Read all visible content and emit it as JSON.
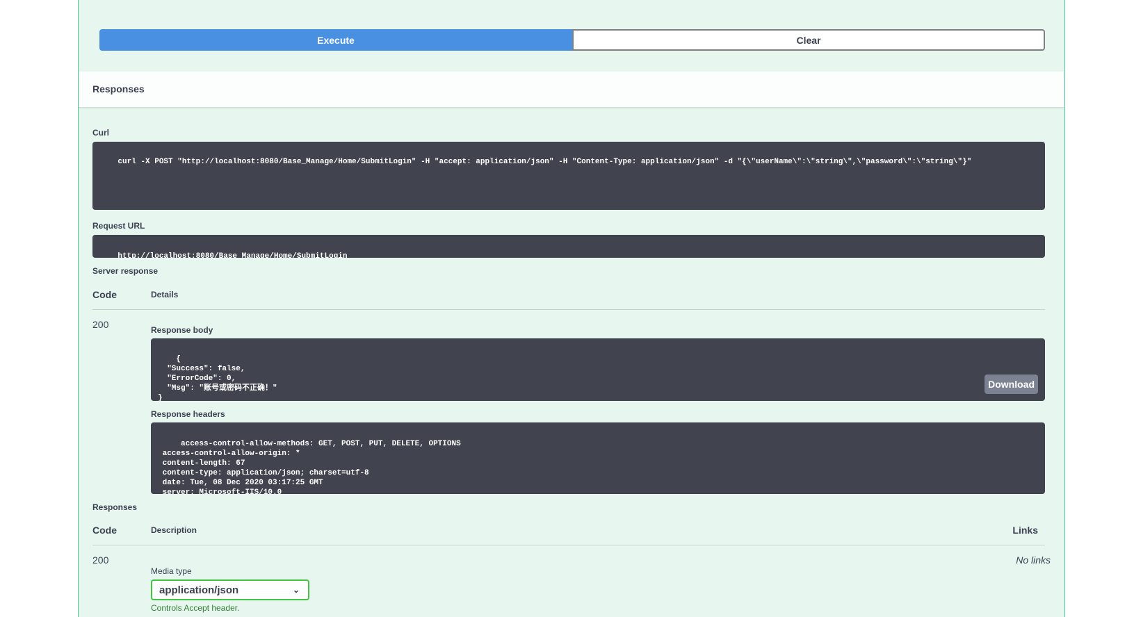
{
  "buttons": {
    "execute": "Execute",
    "clear": "Clear"
  },
  "responses_title": "Responses",
  "curl": {
    "label": "Curl",
    "command": "curl -X POST \"http://localhost:8080/Base_Manage/Home/SubmitLogin\" -H \"accept: application/json\" -H \"Content-Type: application/json\" -d \"{\\\"userName\\\":\\\"string\\\",\\\"password\\\":\\\"string\\\"}\""
  },
  "request_url": {
    "label": "Request URL",
    "value": "http://localhost:8080/Base_Manage/Home/SubmitLogin"
  },
  "server_response": {
    "label": "Server response",
    "col_code": "Code",
    "col_details": "Details",
    "code": "200",
    "body_label": "Response body",
    "body": "{\n  \"Success\": false,\n  \"ErrorCode\": 0,\n  \"Msg\": \"账号或密码不正确！\"\n}",
    "download_label": "Download",
    "headers_label": "Response headers",
    "headers": " access-control-allow-methods: GET, POST, PUT, DELETE, OPTIONS \n access-control-allow-origin: * \n content-length: 67 \n content-type: application/json; charset=utf-8 \n date: Tue, 08 Dec 2020 03:17:25 GMT \n server: Microsoft-IIS/10.0 "
  },
  "responses": {
    "label": "Responses",
    "col_code": "Code",
    "col_description": "Description",
    "col_links": "Links",
    "code": "200",
    "no_links": "No links",
    "media_type_label": "Media type",
    "media_type_value": "application/json",
    "controls_note": "Controls Accept header."
  },
  "colors": {
    "execute": "#4990e2",
    "block_bg": "#e8f6f0",
    "block_border": "#49cc90",
    "code_bg": "#41444e",
    "select_border": "#41c541"
  }
}
